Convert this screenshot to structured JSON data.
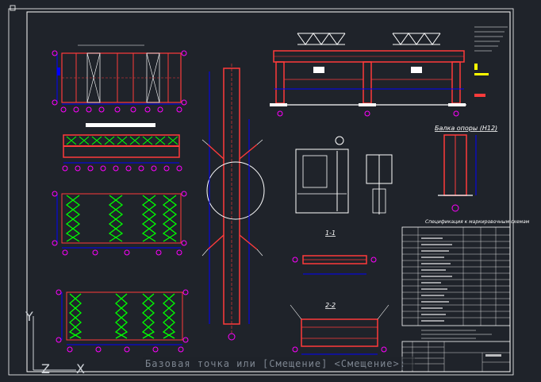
{
  "command_line": {
    "prompt": "Базовая точка или [Смещение] <Смещение>:"
  },
  "ucs": {
    "x_label": "X",
    "y_label": "Y",
    "z_label": "Z"
  },
  "labels": {
    "section_1": "1-1",
    "section_2": "2-2",
    "beam_title": "Балка опоры (Н12)",
    "spec_title": "Спецификация к маркировочным схемам"
  },
  "colors": {
    "background": "#1f232a",
    "frame": "#ffffff",
    "member": "#ff3b3b",
    "dimension": "#0000ff",
    "axis_marker": "#ff00ff",
    "bracing": "#00ff00",
    "annotation": "#ffff00",
    "command_text": "#7d8590"
  }
}
